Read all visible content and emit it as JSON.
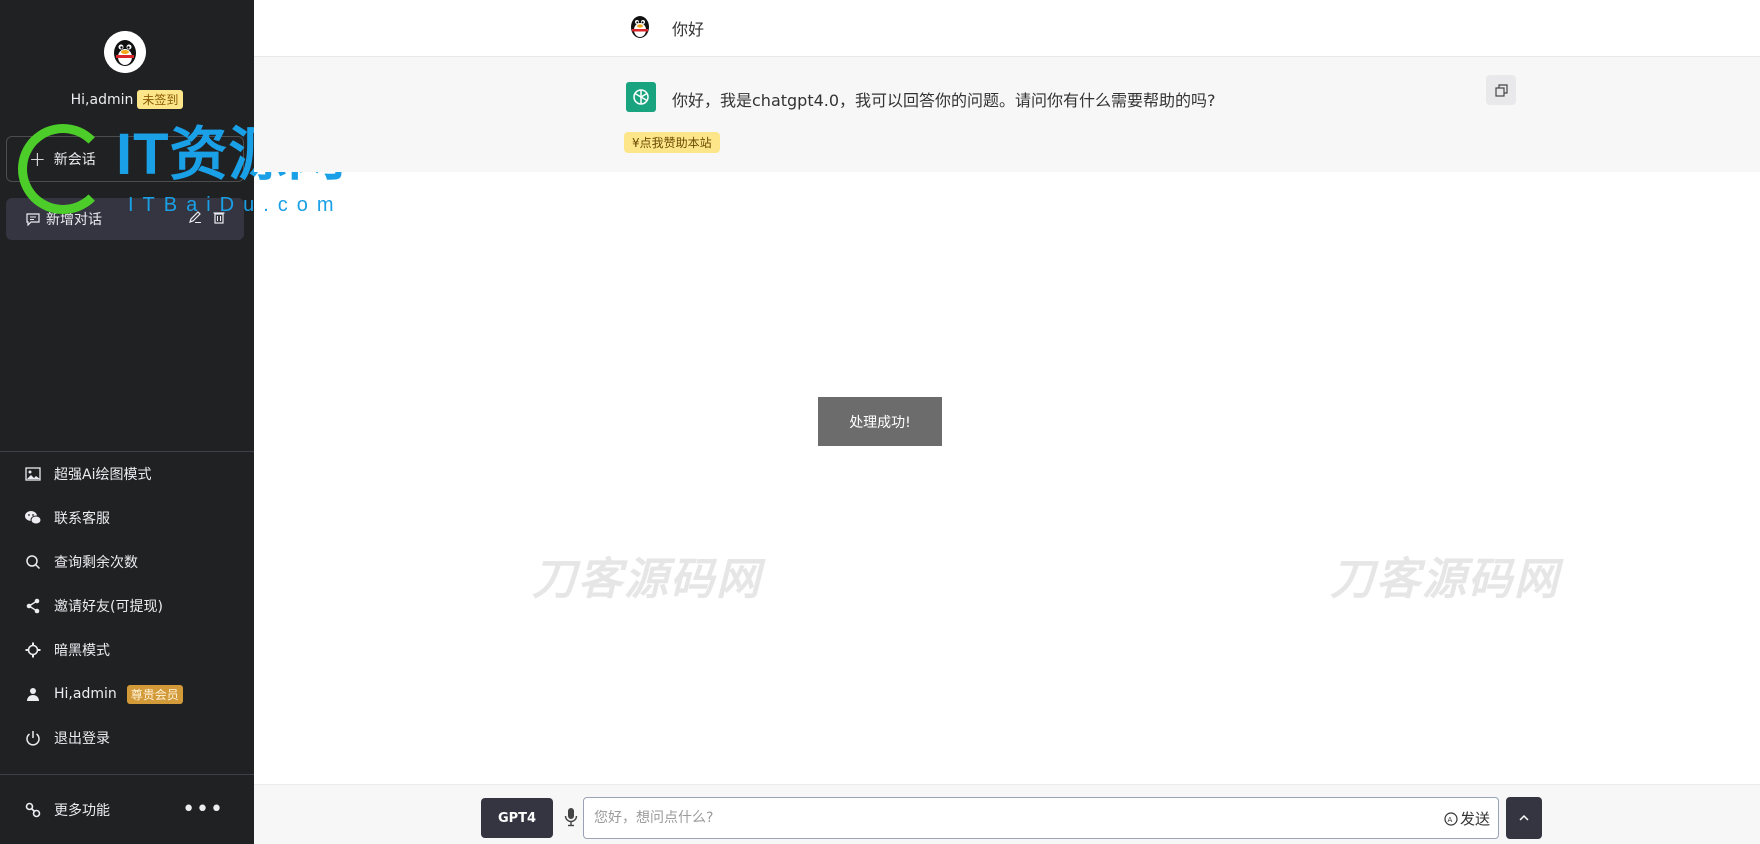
{
  "sidebar": {
    "greeting": "Hi,admin",
    "checkin_badge": "未签到",
    "new_chat_label": "新会话",
    "conversations": [
      {
        "title": "新增对话"
      }
    ],
    "menu": [
      {
        "label": "超强Ai绘图模式",
        "icon": "image-icon"
      },
      {
        "label": "联系客服",
        "icon": "wechat-icon"
      },
      {
        "label": "查询剩余次数",
        "icon": "search-icon"
      },
      {
        "label": "邀请好友(可提现)",
        "icon": "share-icon"
      },
      {
        "label": "暗黑模式",
        "icon": "gear-icon"
      },
      {
        "label": "Hi,admin",
        "icon": "user-icon",
        "badge": "尊贵会员"
      },
      {
        "label": "退出登录",
        "icon": "power-icon"
      }
    ],
    "more_label": "更多功能"
  },
  "logo": {
    "text": "IT资源网",
    "sub": "ITBaiDu.com"
  },
  "chat": {
    "user_message": "你好",
    "bot_message": "你好，我是chatgpt4.0，我可以回答你的问题。请问你有什么需要帮助的吗?",
    "sponsor_label": "¥点我赞助本站"
  },
  "toast": "处理成功!",
  "watermark": "刀客源码网",
  "composer": {
    "model_label": "GPT4",
    "placeholder": "您好，想问点什么?",
    "send_label": "发送"
  },
  "colors": {
    "sidebar_bg": "#202123",
    "accent_green": "#19a37f",
    "badge_yellow": "#fde68a",
    "badge_gold": "#d39a3a",
    "logo_blue": "#1aa0e6",
    "logo_green": "#4ccd2a"
  }
}
